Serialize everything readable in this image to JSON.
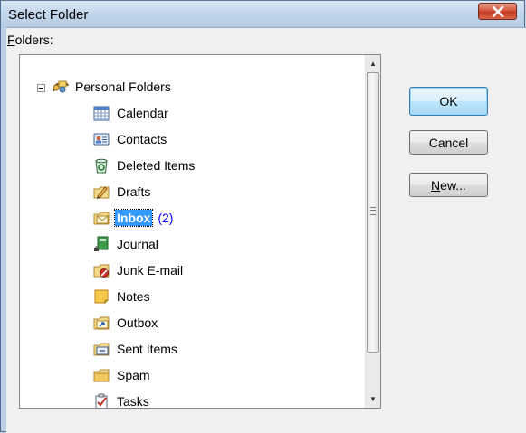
{
  "window": {
    "title": "Select Folder"
  },
  "folders_label": {
    "accesskey": "F",
    "rest": "olders:"
  },
  "tree": {
    "root": {
      "label": "Personal Folders",
      "icon": "personal-folders-icon"
    },
    "items": [
      {
        "label": "Calendar",
        "icon": "calendar-icon",
        "count": ""
      },
      {
        "label": "Contacts",
        "icon": "contacts-icon",
        "count": ""
      },
      {
        "label": "Deleted Items",
        "icon": "deleted-items-icon",
        "count": ""
      },
      {
        "label": "Drafts",
        "icon": "drafts-icon",
        "count": ""
      },
      {
        "label": "Inbox",
        "icon": "inbox-icon",
        "count": "(2)",
        "selected": true
      },
      {
        "label": "Journal",
        "icon": "journal-icon",
        "count": ""
      },
      {
        "label": "Junk E-mail",
        "icon": "junk-email-icon",
        "count": ""
      },
      {
        "label": "Notes",
        "icon": "notes-icon",
        "count": ""
      },
      {
        "label": "Outbox",
        "icon": "outbox-icon",
        "count": ""
      },
      {
        "label": "Sent Items",
        "icon": "sent-items-icon",
        "count": ""
      },
      {
        "label": "Spam",
        "icon": "folder-icon",
        "count": ""
      },
      {
        "label": "Tasks",
        "icon": "tasks-icon",
        "count": ""
      }
    ]
  },
  "buttons": {
    "ok": "OK",
    "cancel": "Cancel",
    "new_accesskey": "N",
    "new_rest": "ew..."
  },
  "colors": {
    "selection": "#3399ff",
    "count": "#0000ff",
    "close_button": "#c33a21"
  }
}
